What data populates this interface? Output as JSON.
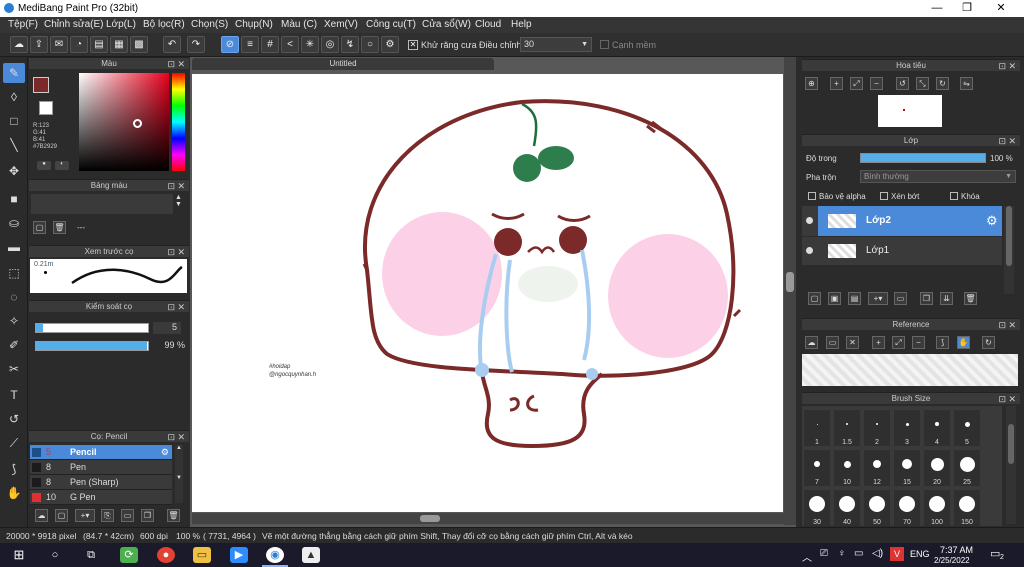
{
  "window": {
    "title": "MediBang Paint Pro (32bit)",
    "minimize": "—",
    "maximize": "❐",
    "close": "✕"
  },
  "menu": [
    "Tệp(F)",
    "Chỉnh sửa(E)",
    "Lớp(L)",
    "Bộ lọc(R)",
    "Chọn(S)",
    "Chụp(N)",
    "Màu (C)",
    "Xem(V)",
    "Công cụ(T)",
    "Cửa sổ(W)",
    "Cloud",
    "Help"
  ],
  "toolbar": {
    "antialias_label": "Khử răng cưa",
    "adjust_label": "Điều chỉnh",
    "adjust_value": "30",
    "edge_label": "Cạnh mềm"
  },
  "color_panel": {
    "title": "Màu",
    "r": "R:123",
    "g": "G:41",
    "b": "B:41",
    "hex": "#7B2929",
    "main_color": "#7B2929"
  },
  "palette_panel": {
    "title": "Bảng màu",
    "value": "---"
  },
  "brush_preview": {
    "title": "Xem trước cọ",
    "size_label": "0.21m"
  },
  "brush_control": {
    "title": "Kiểm soát cọ",
    "size": "5",
    "opacity": "99 %",
    "opacity_fraction": 0.99
  },
  "brush_list": {
    "title": "Cọ: Pencil",
    "items": [
      {
        "size": "5",
        "name": "Pencil",
        "color": "#1b4f8a"
      },
      {
        "size": "8",
        "name": "Pen",
        "color": "#1b1b1b"
      },
      {
        "size": "8",
        "name": "Pen (Sharp)",
        "color": "#1b1b1b"
      },
      {
        "size": "10",
        "name": "G Pen",
        "color": "#e03030"
      }
    ]
  },
  "canvas": {
    "tab": "Untitled",
    "watermark1": "#hoidap",
    "watermark2": "@ngocquynhan.h"
  },
  "navigator": {
    "title": "Hoa tiêu"
  },
  "layer_panel": {
    "title": "Lớp",
    "opacity_label": "Độ trong",
    "opacity_value": "100 %",
    "blend_label": "Pha trộn",
    "blend_value": "Bình thường",
    "protect_alpha": "Bảo vệ alpha",
    "clip": "Xén bớt",
    "lock": "Khóa",
    "layers": [
      {
        "name": "Lớp2",
        "selected": true
      },
      {
        "name": "Lớp1",
        "selected": false
      }
    ]
  },
  "reference": {
    "title": "Reference"
  },
  "brush_size": {
    "title": "Brush Size",
    "rows": [
      [
        "1",
        "1.5",
        "2",
        "3",
        "4",
        "5"
      ],
      [
        "7",
        "10",
        "12",
        "15",
        "20",
        "25"
      ],
      [
        "30",
        "40",
        "50",
        "70",
        "100",
        "150"
      ]
    ]
  },
  "status": {
    "size": "20000 * 9918 pixel",
    "cm": "(84.7 * 42cm)",
    "dpi": "600 dpi",
    "zoom": "100 %",
    "coords": "( 7731, 4964 )",
    "hint": "Vẽ một đường thẳng bằng cách giữ phím Shift, Thay đổi cỡ cọ bằng cách giữ phím Ctrl, Alt và kéo"
  },
  "taskbar": {
    "lang": "ENG",
    "time": "7:37 AM",
    "date": "2/25/2022",
    "notify_count": "2"
  }
}
